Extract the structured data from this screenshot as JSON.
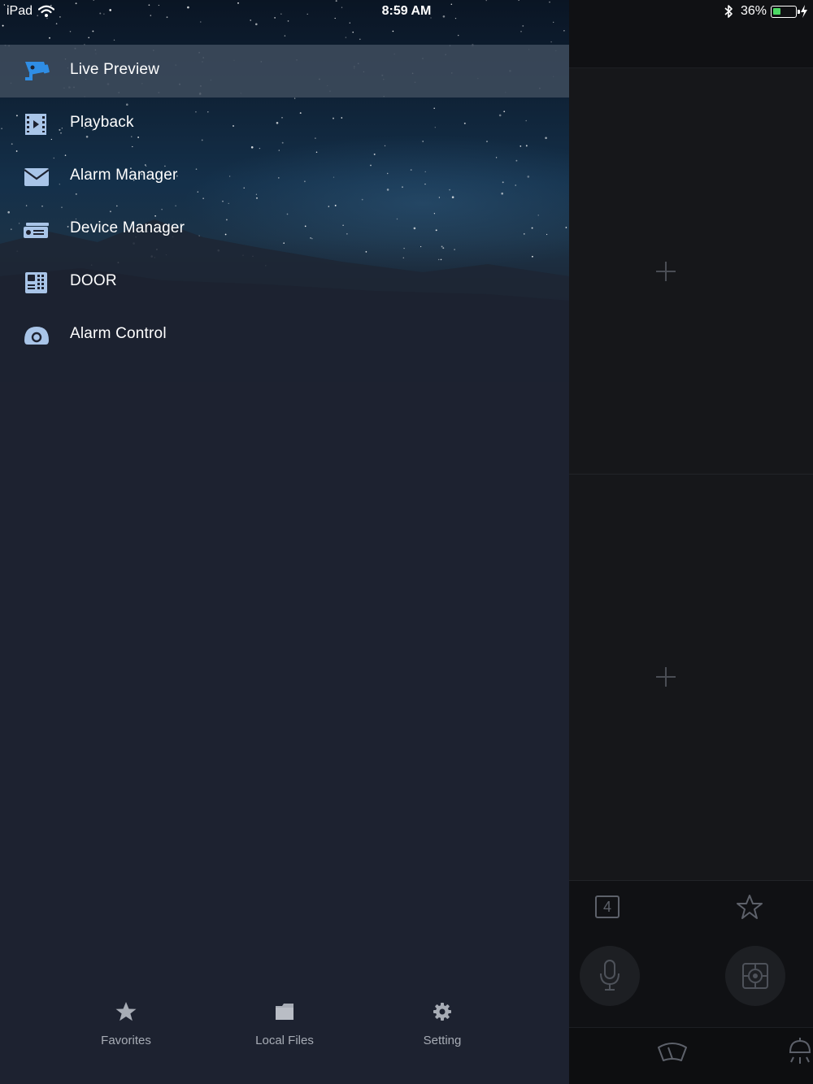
{
  "status_bar": {
    "device": "iPad",
    "time": "8:59 AM",
    "battery": "36%",
    "battery_level": 0.36
  },
  "menu": {
    "items": [
      {
        "label": "Live Preview",
        "icon": "camera-icon",
        "active": true
      },
      {
        "label": "Playback",
        "icon": "film-play-icon",
        "active": false
      },
      {
        "label": "Alarm Manager",
        "icon": "envelope-icon",
        "active": false
      },
      {
        "label": "Device Manager",
        "icon": "dvr-device-icon",
        "active": false
      },
      {
        "label": "DOOR",
        "icon": "door-station-icon",
        "active": false
      },
      {
        "label": "Alarm Control",
        "icon": "alarm-control-icon",
        "active": false
      }
    ]
  },
  "tabs": [
    {
      "label": "Favorites",
      "icon": "star-icon"
    },
    {
      "label": "Local Files",
      "icon": "folder-icon"
    },
    {
      "label": "Setting",
      "icon": "gear-icon"
    }
  ],
  "background_app": {
    "split_count": "4"
  },
  "colors": {
    "accent": "#2f8de4",
    "icon_inactive": "#a9c5e8",
    "drawer_bg": "#1d2230",
    "active_row": "#3e4b5c",
    "tab_text": "#a7acb5"
  }
}
